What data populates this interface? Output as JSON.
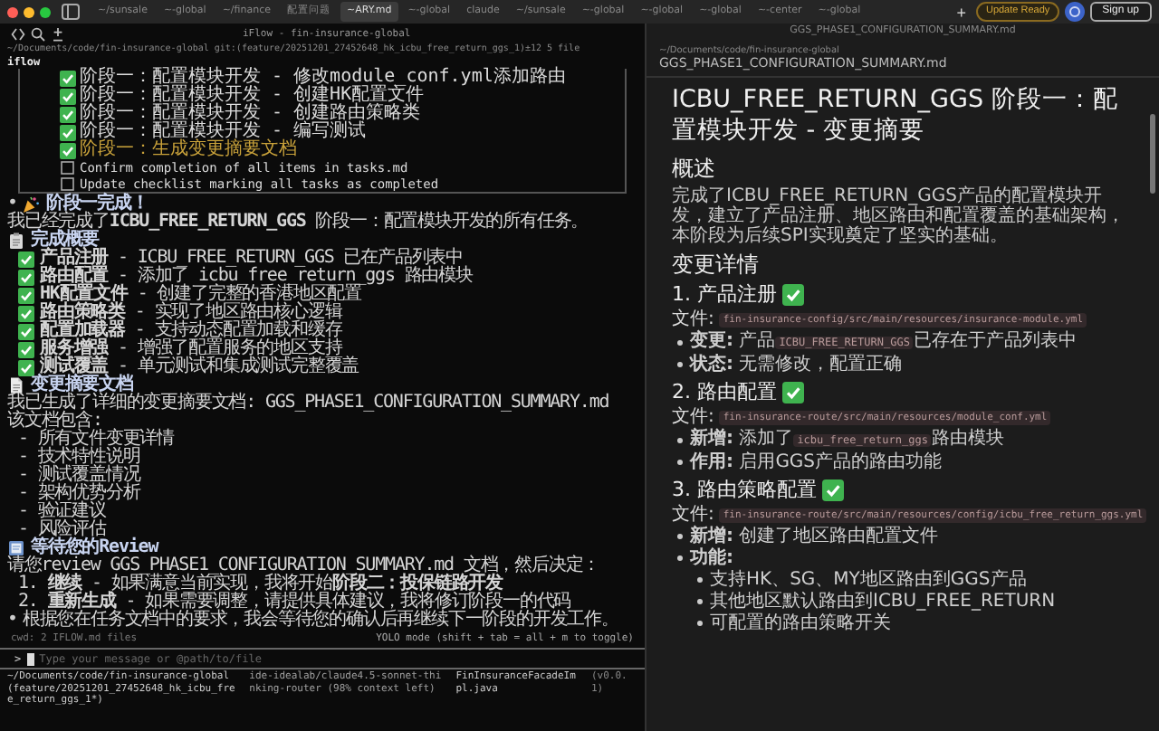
{
  "tabs": [
    {
      "label": "~/sunsale",
      "selected": false
    },
    {
      "label": "~-global",
      "selected": false
    },
    {
      "label": "~/finance",
      "selected": false
    },
    {
      "label": "配置问题",
      "selected": false
    },
    {
      "label": "~ARY.md",
      "selected": true
    },
    {
      "label": "~-global",
      "selected": false
    },
    {
      "label": "claude",
      "selected": false
    },
    {
      "label": "~/sunsale",
      "selected": false
    },
    {
      "label": "~-global",
      "selected": false
    },
    {
      "label": "~-global",
      "selected": false
    },
    {
      "label": "~-global",
      "selected": false
    },
    {
      "label": "~-center",
      "selected": false
    },
    {
      "label": "~-global",
      "selected": false
    }
  ],
  "new_tab": "+",
  "update_button": "Update Ready",
  "sign_up_button": "Sign up",
  "left_pane": {
    "title": "iFlow - fin-insurance-global",
    "path": "~/Documents/code/fin-insurance-global git:(feature/20251201_27452648_hk_icbu_free_return_ggs_1)±12  5 file",
    "app_name": "iflow",
    "tasks": [
      {
        "text": "阶段一：配置模块开发 - 修改module_conf.yml添加路由",
        "checked": true,
        "highlighted": false
      },
      {
        "text": "阶段一：配置模块开发 - 创建HK配置文件",
        "checked": true,
        "highlighted": false
      },
      {
        "text": "阶段一：配置模块开发 - 创建路由策略类",
        "checked": true,
        "highlighted": false
      },
      {
        "text": "阶段一：配置模块开发 - 编写测试",
        "checked": true,
        "highlighted": false
      },
      {
        "text": "阶段一：生成变更摘要文档",
        "checked": true,
        "highlighted": true
      },
      {
        "text": "Confirm completion of all items in tasks.md",
        "checked": false,
        "highlighted": false
      },
      {
        "text": "Update checklist marking all tasks as completed",
        "checked": false,
        "highlighted": false
      }
    ],
    "transcript": [
      {
        "kind": "celebrate",
        "marker": "•",
        "text": "阶段一完成！"
      },
      {
        "kind": "text",
        "text": "我已经完成了**ICBU_FREE_RETURN_GGS** 阶段一：配置模块开发的所有任务。"
      },
      {
        "kind": "summary",
        "text": "完成概要"
      },
      {
        "kind": "check",
        "checked": true,
        "text": "**产品注册** - ICBU_FREE_RETURN_GGS 已在产品列表中"
      },
      {
        "kind": "check",
        "checked": true,
        "text": "**路由配置** - 添加了 icbu_free_return_ggs 路由模块"
      },
      {
        "kind": "check",
        "checked": true,
        "text": "**HK配置文件** - 创建了完整的香港地区配置"
      },
      {
        "kind": "check",
        "checked": true,
        "text": "**路由策略类** - 实现了地区路由核心逻辑"
      },
      {
        "kind": "check",
        "checked": true,
        "text": "**配置加载器** - 支持动态配置加载和缓存"
      },
      {
        "kind": "check",
        "checked": true,
        "text": "**服务增强** - 增强了配置服务的地区支持"
      },
      {
        "kind": "check",
        "checked": true,
        "text": "**测试覆盖** - 单元测试和集成测试完整覆盖"
      },
      {
        "kind": "document",
        "text": "变更摘要文档"
      },
      {
        "kind": "text",
        "text": "我已生成了详细的变更摘要文档: GGS_PHASE1_CONFIGURATION_SUMMARY.md"
      },
      {
        "kind": "text",
        "text": "该文档包含:"
      },
      {
        "kind": "item",
        "text": "- 所有文件变更详情"
      },
      {
        "kind": "item",
        "text": "- 技术特性说明"
      },
      {
        "kind": "item",
        "text": "- 测试覆盖情况"
      },
      {
        "kind": "item",
        "text": "- 架构优势分析"
      },
      {
        "kind": "item",
        "text": "- 验证建议"
      },
      {
        "kind": "item",
        "text": "- 风险评估"
      },
      {
        "kind": "review",
        "text": "等待您的Review"
      },
      {
        "kind": "text",
        "text": "请您review GGS_PHASE1_CONFIGURATION_SUMMARY.md 文档，然后决定："
      },
      {
        "kind": "item",
        "text": "1. **继续** - 如果满意当前实现，我将开始**阶段二：投保链路开发**"
      },
      {
        "kind": "item",
        "text": "2. **重新生成** - 如果需要调整，请提供具体建议，我将修订阶段一的代码"
      },
      {
        "kind": "note",
        "marker": "•",
        "text": "根据您在任务文档中的要求，我会等待您的确认后再继续下一阶段的开发工作。"
      }
    ],
    "status_left": "cwd: 2 IFLOW.md files",
    "status_right": "YOLO mode (shift + tab = all + m to toggle)",
    "prompt": ">",
    "input_placeholder": "Type your message or @path/to/file",
    "footer": [
      "~/Documents/code/fin-insurance-global (feature/20251201_27452648_hk_icbu_free_return_ggs_1*)",
      "ide-idealab/claude4.5-sonnet-thinking-router (98% context left)",
      "FinInsuranceFacadeImpl.java",
      "(v0.0.1)"
    ]
  },
  "right_pane": {
    "title": "GGS_PHASE1_CONFIGURATION_SUMMARY.md",
    "path": "~/Documents/code/fin-insurance-global",
    "file_name": "GGS_PHASE1_CONFIGURATION_SUMMARY.md",
    "heading": "ICBU_FREE_RETURN_GGS 阶段一：配置模块开发 - 变更摘要",
    "overview_heading": "概述",
    "overview": "完成了ICBU_FREE_RETURN_GGS产品的配置模块开发，建立了产品注册、地区路由和配置覆盖的基础架构，本阶段为后续SPI实现奠定了坚实的基础。",
    "details_heading": "变更详情",
    "changes": [
      {
        "heading": "1. 产品注册",
        "done": true,
        "file_label": "文件:",
        "file": "fin-insurance-config/src/main/resources/insurance-module.yml",
        "items": [
          {
            "label": "变更:",
            "before": "产品",
            "code": "ICBU_FREE_RETURN_GGS",
            "after": "已存在于产品列表中"
          },
          {
            "label": "状态:",
            "after": "无需修改，配置正确"
          }
        ]
      },
      {
        "heading": "2. 路由配置",
        "done": true,
        "file_label": "文件:",
        "file": "fin-insurance-route/src/main/resources/module_conf.yml",
        "items": [
          {
            "label": "新增:",
            "before": "添加了",
            "code": "icbu_free_return_ggs",
            "after": "路由模块"
          },
          {
            "label": "作用:",
            "after": "启用GGS产品的路由功能"
          }
        ]
      },
      {
        "heading": "3. 路由策略配置",
        "done": true,
        "file_label": "文件:",
        "file": "fin-insurance-route/src/main/resources/config/icbu_free_return_ggs.yml",
        "items": [
          {
            "label": "新增:",
            "after": "创建了地区路由配置文件"
          },
          {
            "label": "功能:",
            "children": [
              "支持HK、SG、MY地区路由到GGS产品",
              "其他地区默认路由到ICBU_FREE_RETURN",
              "可配置的路由策略开关"
            ]
          }
        ]
      }
    ]
  }
}
